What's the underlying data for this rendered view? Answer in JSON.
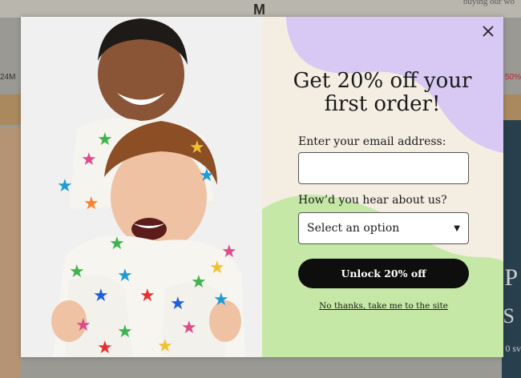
{
  "background": {
    "top_right_text": "buying our wo",
    "brand_letter": "M",
    "left_text": "24M",
    "right_text": "50%",
    "right_big_1": "P",
    "right_big_2": "S",
    "right_small": "0 sv"
  },
  "modal": {
    "headline": "Get 20% off your first order!",
    "email_label": "Enter your email address:",
    "email_value": "",
    "email_placeholder": "",
    "hear_label": "How’d you hear about us?",
    "select_value": "Select an option",
    "submit_label": "Unlock 20% off",
    "decline_label": "No thanks, take me to the site",
    "close_icon": "close-icon",
    "select_icon": "triangle-down-icon"
  },
  "colors": {
    "modal_bg": "#f3ede2",
    "lavender": "#d7c9f4",
    "green": "#c6e8a6",
    "button": "#0e0e0e"
  }
}
